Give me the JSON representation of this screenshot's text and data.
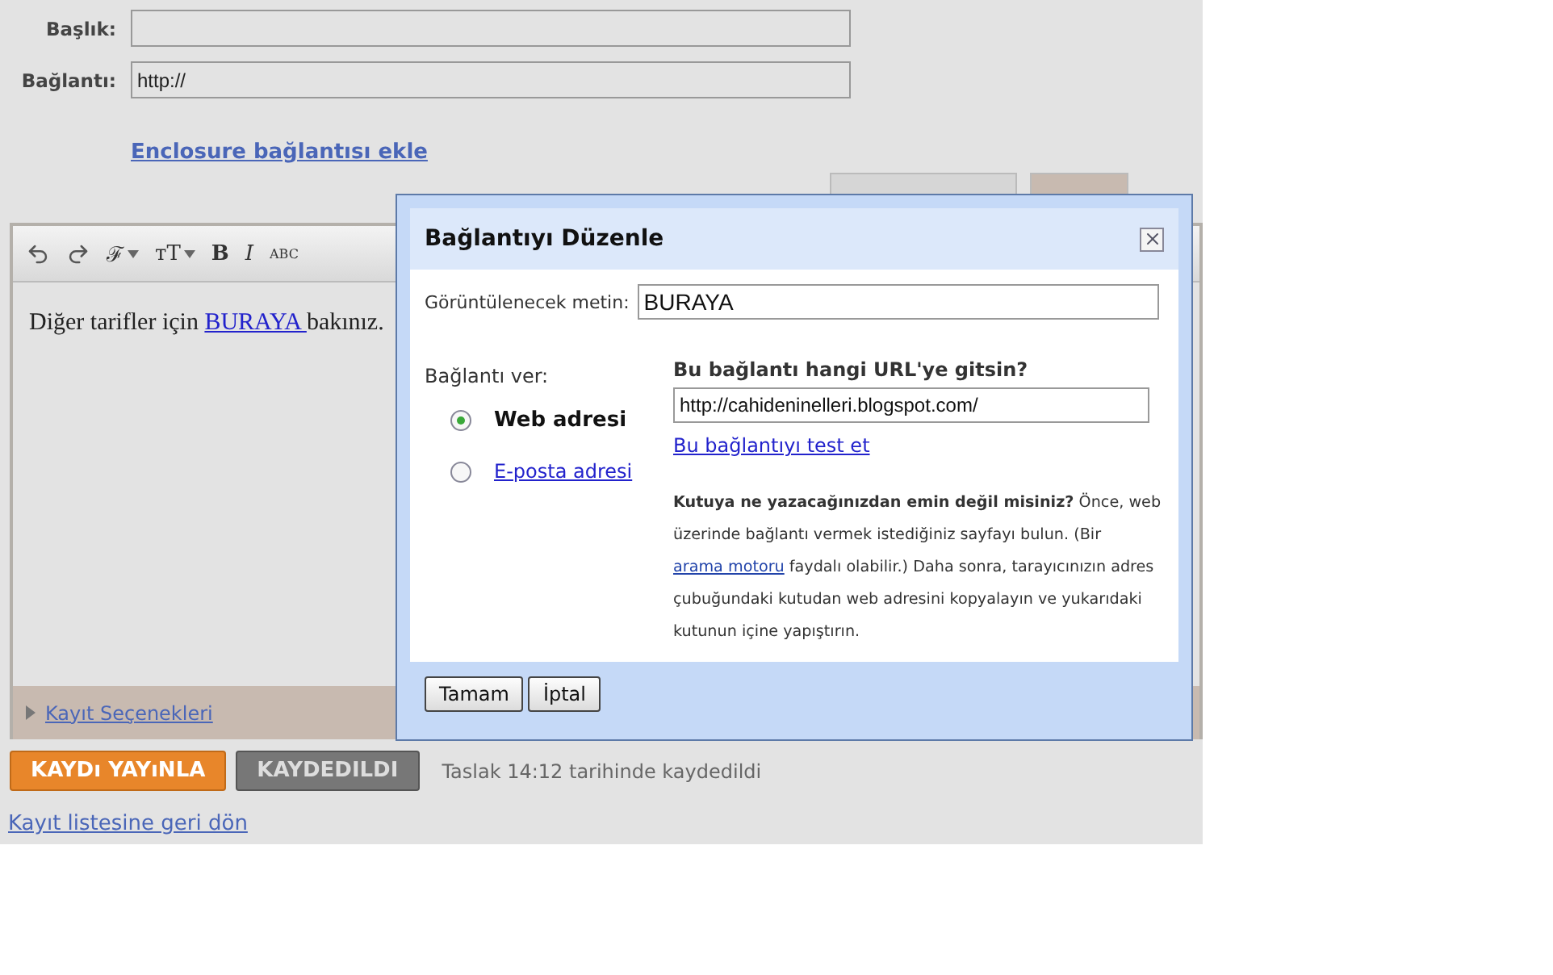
{
  "form": {
    "fields": [
      {
        "label": "Başlık:"
      },
      {
        "label": "Bağlantı:",
        "value": "http://"
      }
    ],
    "enclosure_link": "Enclosure bağlantısı ekle"
  },
  "editor": {
    "toolbar": [
      {
        "kind": "undo"
      },
      {
        "kind": "redo"
      },
      {
        "kind": "font",
        "label": "ℱ"
      },
      {
        "kind": "size",
        "label": "тT"
      },
      {
        "kind": "bold",
        "label": "B"
      },
      {
        "kind": "italic",
        "label": "I"
      },
      {
        "kind": "spellcheck",
        "label": "ABC"
      }
    ],
    "content": {
      "before": "Diğer tarifler için ",
      "link": "BURAYA ",
      "after": "bakınız."
    },
    "options_link": "Kayıt Seçenekleri"
  },
  "actions": {
    "publish": "KAYDı YAYıNLA",
    "saved": "KAYDEDILDI",
    "status": "Taslak 14:12 tarihinde kaydedildi",
    "back_link": "Kayıt listesine geri dön"
  },
  "dialog": {
    "title": "Bağlantıyı Düzenle",
    "display_text_label": "Görüntülenecek metin:",
    "display_text": "BURAYA",
    "link_to_label": "Bağlantı ver:",
    "options": [
      {
        "label": "Web adresi",
        "selected": true
      },
      {
        "label": "E-posta adresi",
        "selected": false
      }
    ],
    "url_question": "Bu bağlantı hangi URL'ye gitsin?",
    "url": "http://cahideninelleri.blogspot.com/",
    "test_link": "Bu bağlantıyı test et",
    "help": {
      "lead": "Kutuya ne yazacağınızdan emin değil misiniz?",
      "text_1": " Önce, web üzerinde bağlantı vermek istediğiniz sayfayı bulun. (Bir ",
      "link": "arama motoru",
      "text_2": " faydalı olabilir.) Daha sonra, tarayıcınızın adres çubuğundaki kutudan web adresini kopyalayın ve yukarıdaki kutunun içine yapıştırın."
    },
    "buttons": [
      "Tamam",
      "İptal"
    ]
  }
}
